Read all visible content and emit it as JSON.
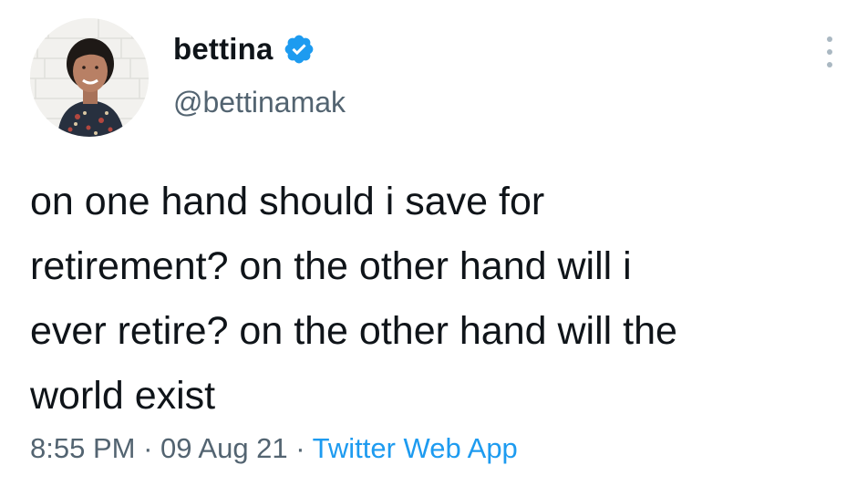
{
  "author": {
    "display_name": "bettina",
    "handle": "@bettinamak",
    "verified": true,
    "avatar_icon": "profile-photo"
  },
  "tweet": {
    "text": "on one hand should i save for\nretirement? on the other hand will i\never retire? on the other hand will the\nworld exist",
    "time": "8:55 PM",
    "date": "09 Aug 21",
    "separator": " · ",
    "source": "Twitter Web App"
  },
  "icons": {
    "verified": "verified-badge-icon",
    "more": "more-options-icon"
  },
  "colors": {
    "text": "#0f1419",
    "secondary": "#536471",
    "link": "#1d9bf0",
    "verified": "#1d9bf0"
  }
}
